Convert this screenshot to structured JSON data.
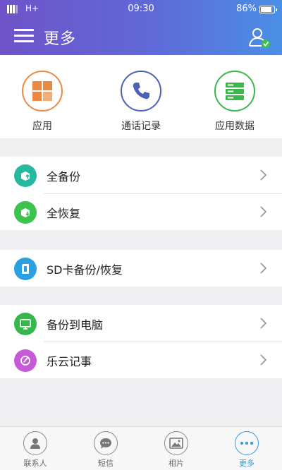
{
  "status_bar": {
    "network": "H+",
    "time": "09:30",
    "battery": "86%"
  },
  "header": {
    "title": "更多"
  },
  "quick_actions": [
    {
      "label": "应用",
      "icon": "apps-grid-icon",
      "color": "#e88a45"
    },
    {
      "label": "通话记录",
      "icon": "phone-icon",
      "color": "#4a63b8"
    },
    {
      "label": "应用数据",
      "icon": "database-icon",
      "color": "#3cb84a"
    }
  ],
  "menu": {
    "full_backup": {
      "label": "全备份",
      "icon": "backup-icon",
      "color": "#26b8a0"
    },
    "full_restore": {
      "label": "全恢复",
      "icon": "restore-icon",
      "color": "#3cc24e"
    },
    "sd_backup": {
      "label": "SD卡备份/恢复",
      "icon": "sd-card-icon",
      "color": "#2aa0e0"
    },
    "pc_backup": {
      "label": "备份到电脑",
      "icon": "computer-icon",
      "color": "#34b84a"
    },
    "notes": {
      "label": "乐云记事",
      "icon": "note-icon",
      "color": "#c65ad6"
    }
  },
  "tabs": [
    {
      "label": "联系人",
      "icon": "contacts-icon",
      "active": false
    },
    {
      "label": "短信",
      "icon": "sms-icon",
      "active": false
    },
    {
      "label": "相片",
      "icon": "photo-icon",
      "active": false
    },
    {
      "label": "更多",
      "icon": "more-icon",
      "active": true
    }
  ],
  "colors": {
    "accent": "#2f9bd6",
    "header_start": "#6f53c9",
    "header_end": "#4a8fe6"
  }
}
